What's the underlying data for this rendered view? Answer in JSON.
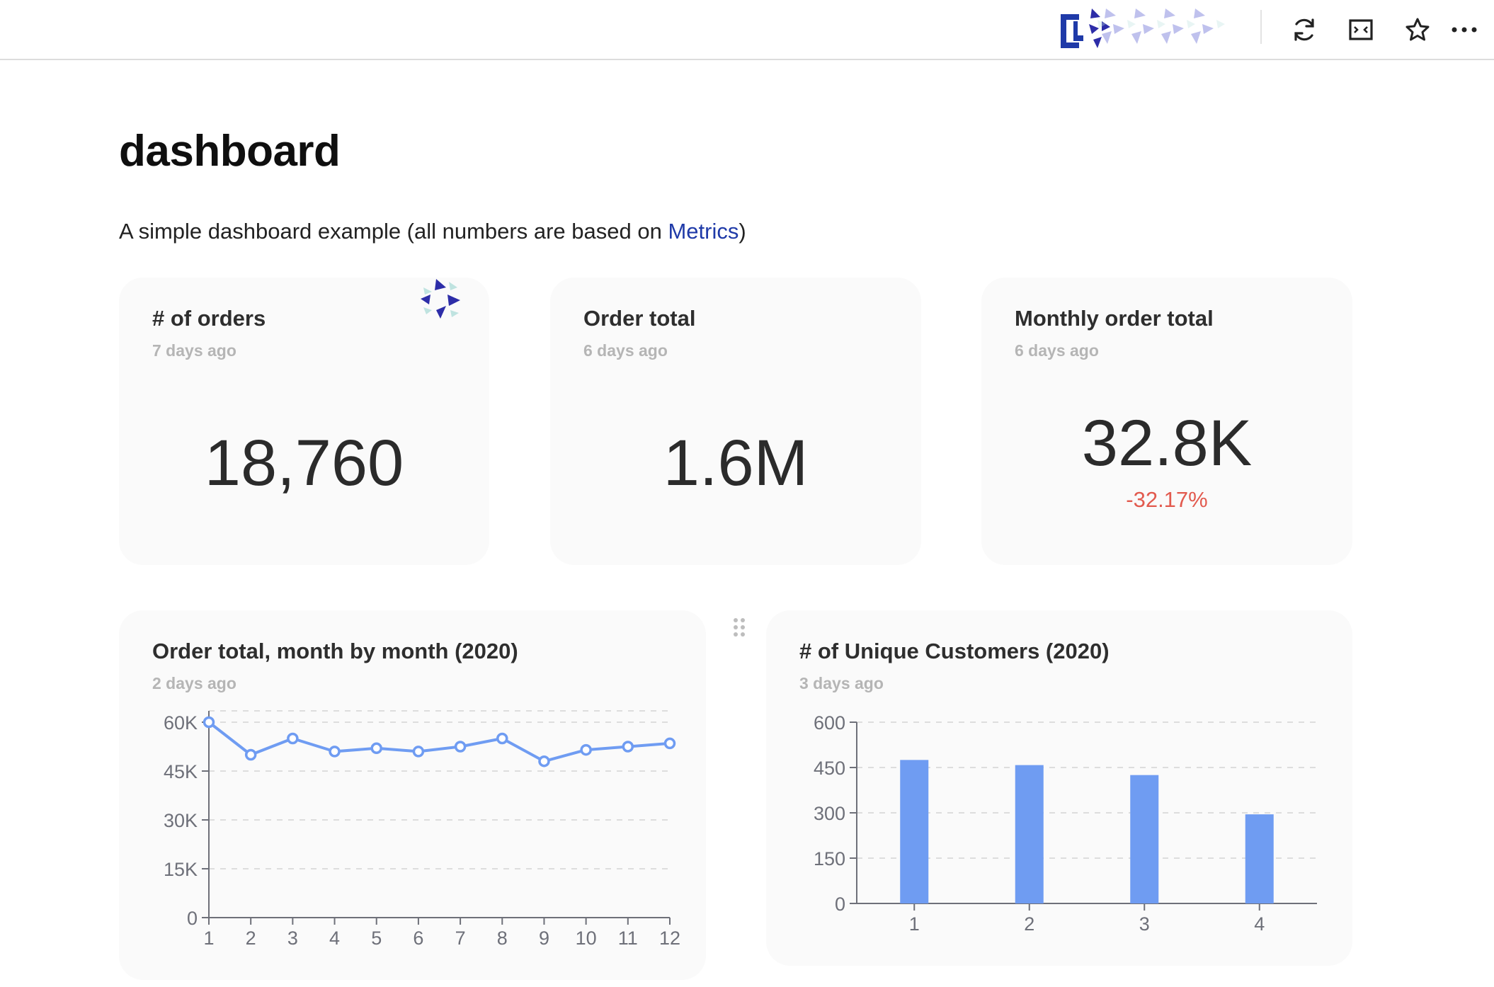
{
  "topbar": {
    "icons": [
      "logo-icon",
      "refresh-icon",
      "fullwidth-icon",
      "star-icon",
      "more-icon"
    ]
  },
  "page": {
    "title": "dashboard",
    "description_prefix": "A simple dashboard example (all numbers are based on ",
    "description_link": "Metrics",
    "description_suffix": ")"
  },
  "cards": [
    {
      "title": "# of orders",
      "updated": "7 days ago",
      "value": "18,760"
    },
    {
      "title": "Order total",
      "updated": "6 days ago",
      "value": "1.6M"
    },
    {
      "title": "Monthly order total",
      "updated": "6 days ago",
      "value": "32.8K",
      "delta": "-32.17%"
    }
  ],
  "charts": {
    "line": {
      "title": "Order total, month by month (2020)",
      "updated": "2 days ago"
    },
    "bar": {
      "title": "# of Unique Customers (2020)",
      "updated": "3 days ago"
    }
  },
  "colors": {
    "series": "#6f9cf2",
    "delta_negative": "#e25a4e",
    "link": "#1f3aa8"
  },
  "chart_data": [
    {
      "type": "line",
      "title": "Order total, month by month (2020)",
      "categories": [
        "1",
        "2",
        "3",
        "4",
        "5",
        "6",
        "7",
        "8",
        "9",
        "10",
        "11",
        "12"
      ],
      "values": [
        60000,
        50000,
        55000,
        51000,
        52000,
        51000,
        52500,
        55000,
        48000,
        51500,
        52500,
        53500
      ],
      "ylim": [
        0,
        60000
      ],
      "yticks": [
        0,
        15000,
        30000,
        45000,
        60000
      ],
      "ytick_labels": [
        "0",
        "15K",
        "30K",
        "45K",
        "60K"
      ],
      "grid": true
    },
    {
      "type": "bar",
      "title": "# of Unique Customers (2020)",
      "categories": [
        "1",
        "2",
        "3",
        "4"
      ],
      "values": [
        475,
        458,
        425,
        295
      ],
      "ylim": [
        0,
        600
      ],
      "yticks": [
        0,
        150,
        300,
        450,
        600
      ],
      "ytick_labels": [
        "0",
        "150",
        "300",
        "450",
        "600"
      ],
      "grid": true
    }
  ]
}
